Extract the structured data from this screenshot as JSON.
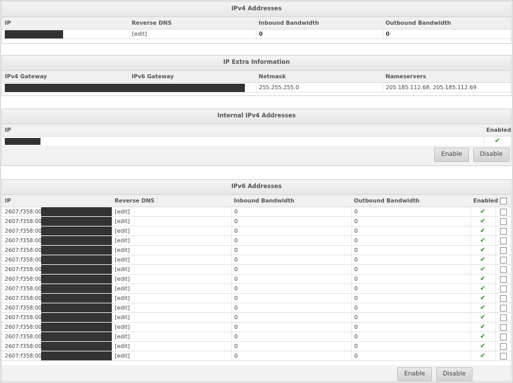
{
  "ipv4": {
    "title": "IPv4 Addresses",
    "headers": [
      "IP",
      "Reverse DNS",
      "Inbound Bandwidth",
      "Outbound Bandwidth"
    ],
    "row": {
      "rdns": "[edit]",
      "inbound": "0",
      "outbound": "0"
    }
  },
  "extra": {
    "title": "IP Extra Information",
    "headers": [
      "IPv4 Gateway",
      "IPv6 Gateway",
      "Netmask",
      "Nameservers"
    ],
    "row": {
      "netmask": "255.255.255.0",
      "nameservers": "205.185.112.68, 205.185.112.69"
    }
  },
  "internal": {
    "title": "Internal IPv4 Addresses",
    "headers": [
      "IP",
      "Enabled"
    ],
    "enable_label": "Enable",
    "disable_label": "Disable"
  },
  "ipv6": {
    "title": "IPv6 Addresses",
    "headers": [
      "IP",
      "Reverse DNS",
      "Inbound Bandwidth",
      "Outbound Bandwidth",
      "Enabled"
    ],
    "ip_prefix": "2607:f358:0001",
    "rdns": "[edit]",
    "inbound": "0",
    "outbound": "0",
    "row_count": 16,
    "enable_label": "Enable",
    "disable_label": "Disable"
  },
  "icons": {
    "enabled": "checkmark-icon",
    "select": "checkbox"
  },
  "colors": {
    "check": "#3c9a32",
    "redaction": "#333333"
  }
}
